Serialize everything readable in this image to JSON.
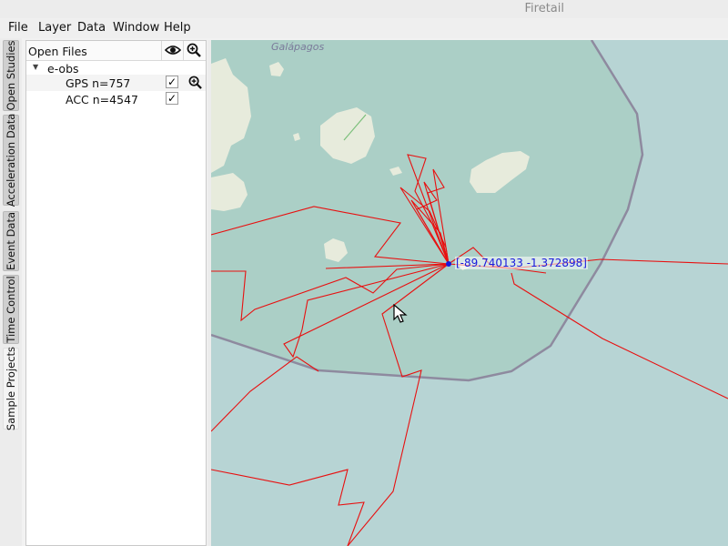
{
  "window": {
    "title": "Firetail"
  },
  "menu": [
    "File",
    "Layer",
    "Data",
    "Window",
    "Help"
  ],
  "side_tabs": [
    "Open Studies",
    "Acceleration Data",
    "Event Data",
    "Time Control",
    "Sample Projects"
  ],
  "panel": {
    "title": "Open Files",
    "group": "e-obs",
    "files": [
      {
        "label": "GPS n=757",
        "checked": "✓"
      },
      {
        "label": "ACC n=4547",
        "checked": "✓"
      }
    ]
  },
  "map": {
    "place_label": "Galápagos",
    "coordinate_label": "[-89.740133 -1.372898]",
    "colors": {
      "land": "#e7ebdc",
      "reserve": "#abcfc6",
      "sea": "#b7d4d4",
      "track": "#e81010",
      "border": "#8e8a9f"
    }
  }
}
